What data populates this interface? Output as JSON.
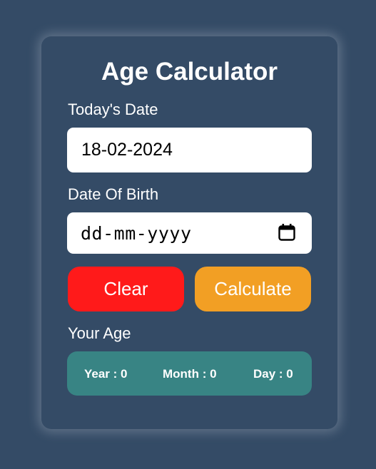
{
  "app": {
    "title": "Age Calculator"
  },
  "today": {
    "label": "Today's Date",
    "value": "18-02-2024"
  },
  "dob": {
    "label": "Date Of Birth",
    "placeholder": "dd-mm-yyyy",
    "icon": "calendar-icon"
  },
  "buttons": {
    "clear_label": "Clear",
    "calculate_label": "Calculate"
  },
  "result": {
    "label": "Your Age",
    "year_text": "Year : 0",
    "month_text": "Month : 0",
    "day_text": "Day : 0"
  },
  "colors": {
    "background": "#344b66",
    "clear": "#ff1a1a",
    "calculate": "#f29f24",
    "result": "#388484"
  }
}
